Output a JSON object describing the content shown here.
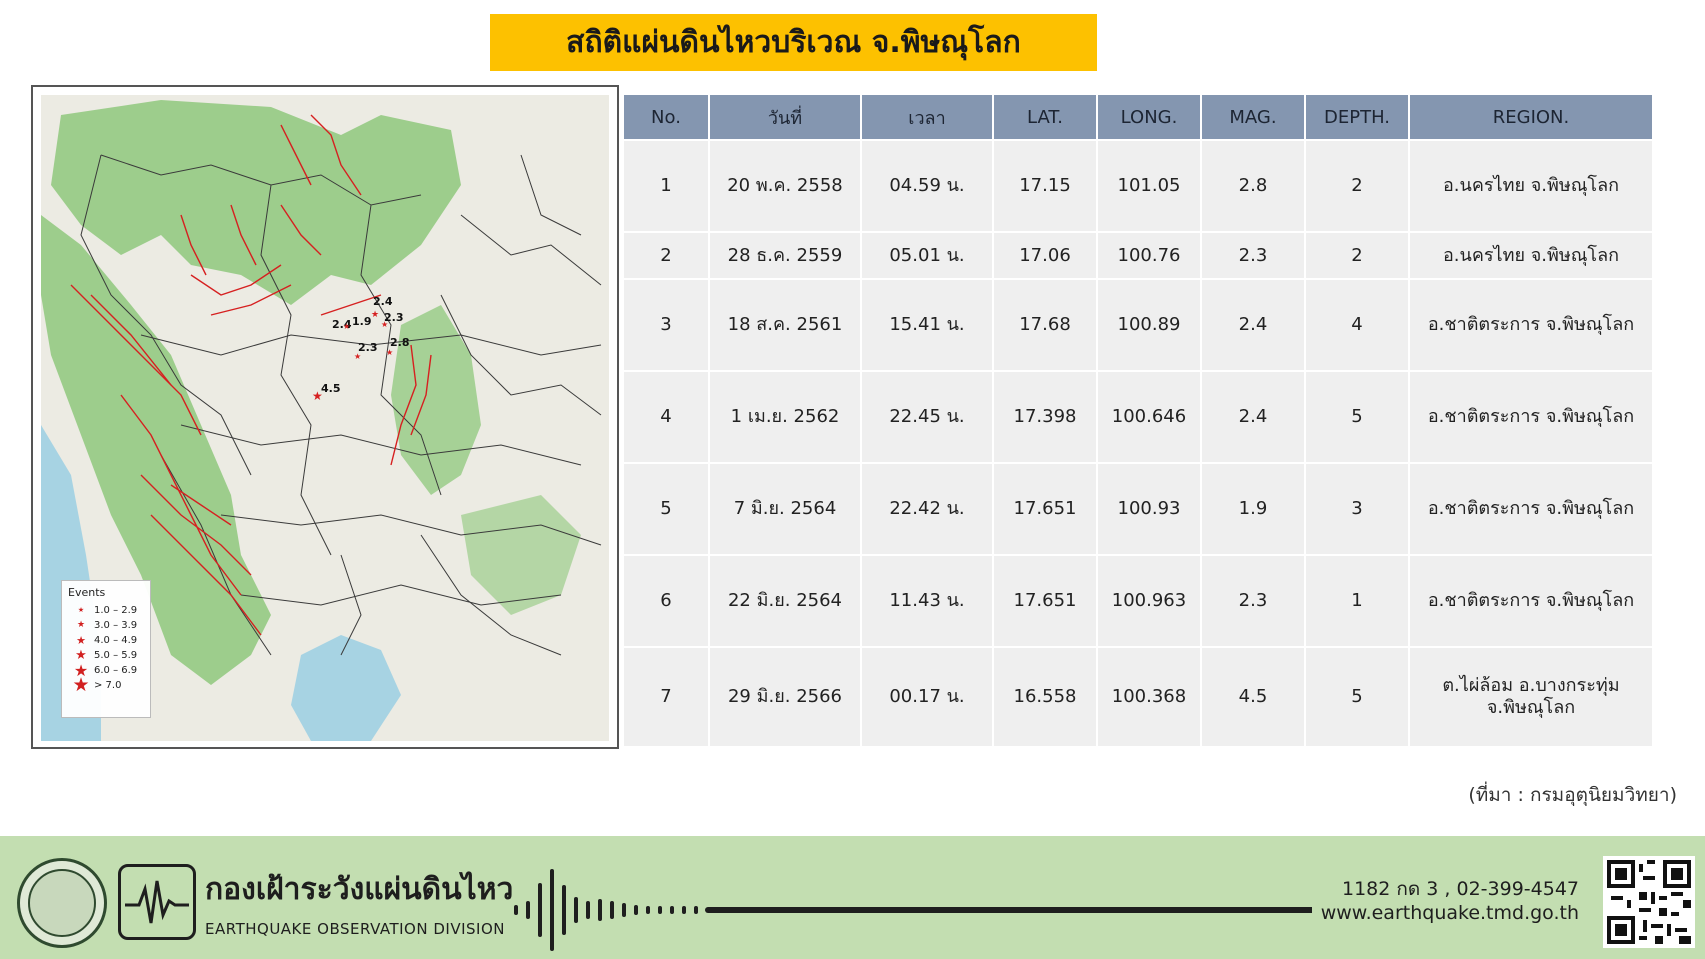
{
  "title": "สถิติแผ่นดินไหวบริเวณ จ.พิษณุโลก",
  "map": {
    "legend": {
      "title": "Events",
      "items": [
        {
          "label": "1.0 – 2.9",
          "size": 1
        },
        {
          "label": "3.0 – 3.9",
          "size": 2
        },
        {
          "label": "4.0 – 4.9",
          "size": 3
        },
        {
          "label": "5.0 – 5.9",
          "size": 4
        },
        {
          "label": "6.0 – 6.9",
          "size": 5
        },
        {
          "label": "> 7.0",
          "size": 6
        }
      ]
    },
    "event_labels": [
      "2.4",
      "2.4",
      "1.9",
      "2.3",
      "2.8",
      "2.3",
      "4.5"
    ],
    "colors": {
      "fault": "#d62020",
      "forest": "#8fc87c",
      "land": "#ecebe3",
      "sea": "#a7d3e3",
      "event": "#d62020"
    }
  },
  "table": {
    "headers": [
      "No.",
      "วันที่",
      "เวลา",
      "LAT.",
      "LONG.",
      "MAG.",
      "DEPTH.",
      "REGION."
    ],
    "rows": [
      [
        "1",
        "20 พ.ค. 2558",
        "04.59 น.",
        "17.15",
        "101.05",
        "2.8",
        "2",
        "อ.นครไทย จ.พิษณุโลก"
      ],
      [
        "2",
        "28 ธ.ค. 2559",
        "05.01 น.",
        "17.06",
        "100.76",
        "2.3",
        "2",
        "อ.นครไทย จ.พิษณุโลก"
      ],
      [
        "3",
        "18 ส.ค. 2561",
        "15.41 น.",
        "17.68",
        "100.89",
        "2.4",
        "4",
        "อ.ชาติตระการ จ.พิษณุโลก"
      ],
      [
        "4",
        "1 เม.ย. 2562",
        "22.45 น.",
        "17.398",
        "100.646",
        "2.4",
        "5",
        "อ.ชาติตระการ จ.พิษณุโลก"
      ],
      [
        "5",
        "7 มิ.ย. 2564",
        "22.42 น.",
        "17.651",
        "100.93",
        "1.9",
        "3",
        "อ.ชาติตระการ จ.พิษณุโลก"
      ],
      [
        "6",
        "22 มิ.ย. 2564",
        "11.43 น.",
        "17.651",
        "100.963",
        "2.3",
        "1",
        "อ.ชาติตระการ จ.พิษณุโลก"
      ],
      [
        "7",
        "29 มิ.ย. 2566",
        "00.17 น.",
        "16.558",
        "100.368",
        "4.5",
        "5",
        "ต.ไผ่ล้อม อ.บางกระทุ่ม จ.พิษณุโลก"
      ]
    ]
  },
  "source": "(ที่มา : กรมอุตุนิยมวิทยา)",
  "footer": {
    "org_thai": "กองเฝ้าระวังแผ่นดินไหว",
    "org_en": "EARTHQUAKE OBSERVATION DIVISION",
    "phone": "1182 กด 3 , 02-399-4547",
    "website": "www.earthquake.tmd.go.th",
    "colors": {
      "band": "#c3deb1",
      "ink": "#1e1e1e"
    }
  }
}
